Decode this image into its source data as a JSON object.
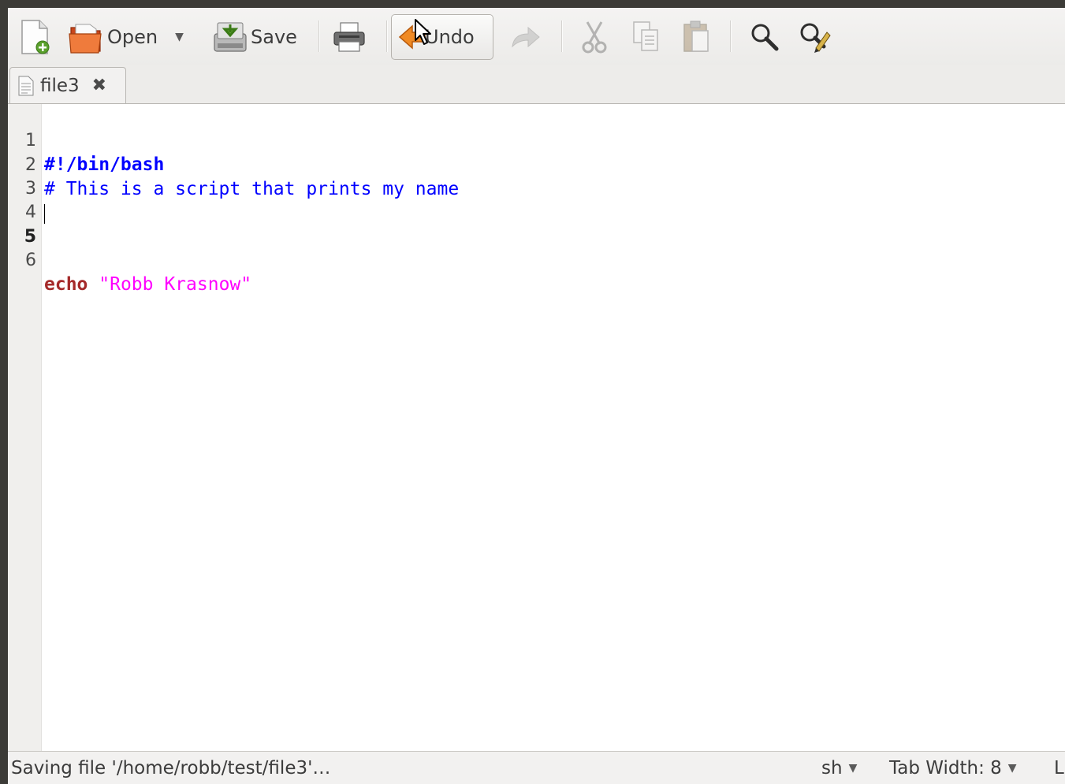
{
  "toolbar": {
    "new": {
      "icon": "new-document-icon"
    },
    "open": {
      "label": "Open",
      "icon": "open-folder-icon",
      "dropdown_icon": "chevron-down-icon"
    },
    "save": {
      "label": "Save",
      "icon": "save-icon"
    },
    "print": {
      "icon": "printer-icon"
    },
    "undo": {
      "label": "Undo",
      "icon": "undo-arrow-icon"
    },
    "redo": {
      "icon": "redo-arrow-icon"
    },
    "cut": {
      "icon": "scissors-icon"
    },
    "copy": {
      "icon": "copy-icon"
    },
    "paste": {
      "icon": "paste-icon"
    },
    "find": {
      "icon": "magnifier-icon"
    },
    "replace": {
      "icon": "find-replace-icon"
    }
  },
  "tabs": [
    {
      "label": "file3",
      "icon": "text-file-icon",
      "close_icon": "close-icon"
    }
  ],
  "editor": {
    "lines": [
      {
        "number": "1",
        "text": "#!/bin/bash"
      },
      {
        "number": "2",
        "text": "# This is a script that prints my name"
      },
      {
        "number": "3",
        "text": ""
      },
      {
        "number": "4",
        "text": ""
      },
      {
        "number": "5",
        "text": ""
      },
      {
        "number": "6",
        "keyword": "echo",
        "string": "\"Robb Krasnow\""
      }
    ],
    "current_line": "5",
    "colors": {
      "comment": "#0000ff",
      "keyword": "#a52a2a",
      "string": "#ff00ff"
    }
  },
  "statusbar": {
    "message": "Saving file '/home/robb/test/file3'…",
    "language": "sh",
    "tab_width": "Tab Width: 8",
    "position_truncated": "L"
  }
}
